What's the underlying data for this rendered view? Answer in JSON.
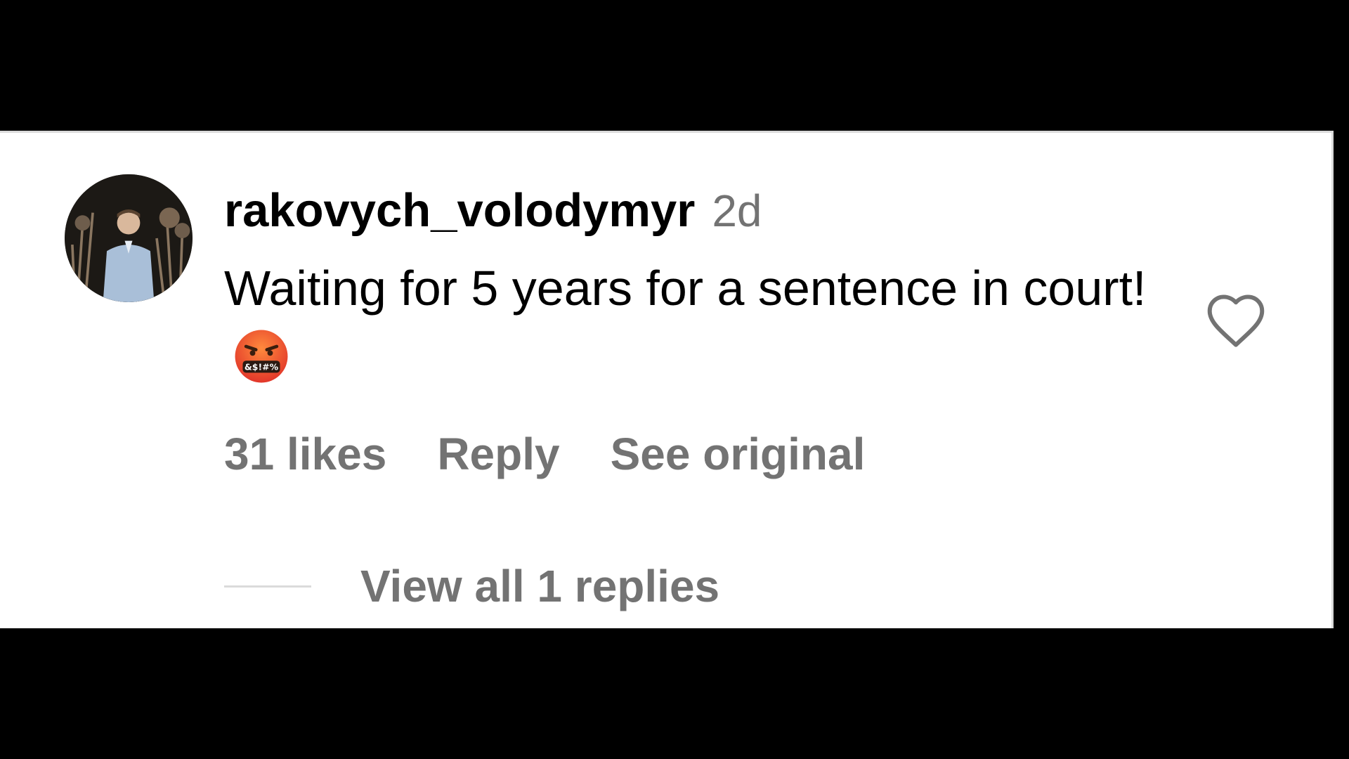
{
  "comment": {
    "username": "rakovych_volodymyr",
    "timestamp": "2d",
    "text": "Waiting for 5 years for a sentence in court!",
    "emoji": "face-with-symbols-on-mouth",
    "emoji_symbols": "&$!#%",
    "avatar_icon": "profile-photo",
    "like_icon": "heart-outline-icon"
  },
  "actions": {
    "likes": "31 likes",
    "reply": "Reply",
    "see_original": "See original"
  },
  "replies": {
    "view_all": "View all 1 replies"
  },
  "colors": {
    "background": "#000000",
    "panel": "#ffffff",
    "primary_text": "#000000",
    "secondary_text": "#737373",
    "divider": "#dbdbdb"
  }
}
